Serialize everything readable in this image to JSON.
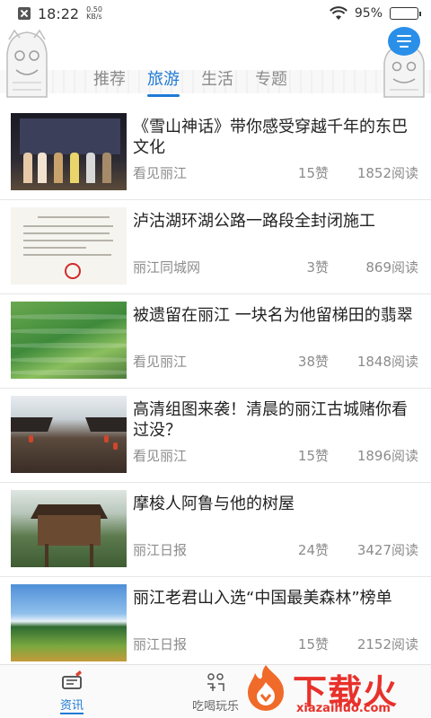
{
  "status_bar": {
    "time": "18:22",
    "speed_value": "0.50",
    "speed_unit": "KB/s",
    "battery": "95%",
    "battery_level": 0.95
  },
  "tabs": [
    {
      "label": "推荐",
      "active": false
    },
    {
      "label": "旅游",
      "active": true
    },
    {
      "label": "生活",
      "active": false
    },
    {
      "label": "专题",
      "active": false
    }
  ],
  "news": [
    {
      "title": "《雪山神话》带你感受穿越千年的东巴文化",
      "source": "看见丽江",
      "likes": "15赞",
      "reads": "1852阅读"
    },
    {
      "title": "泸沽湖环湖公路一路段全封闭施工",
      "source": "丽江同城网",
      "likes": "3赞",
      "reads": "869阅读"
    },
    {
      "title": "被遗留在丽江 一块名为他留梯田的翡翠",
      "source": "看见丽江",
      "likes": "38赞",
      "reads": "1848阅读"
    },
    {
      "title": "高清组图来袭！清晨的丽江古城赌你看过没？",
      "source": "看见丽江",
      "likes": "15赞",
      "reads": "1896阅读"
    },
    {
      "title": "摩梭人阿鲁与他的树屋",
      "source": "丽江日报",
      "likes": "24赞",
      "reads": "3427阅读"
    },
    {
      "title": "丽江老君山入选“中国最美森林”榜单",
      "source": "丽江日报",
      "likes": "15赞",
      "reads": "2152阅读"
    }
  ],
  "bottom_nav": [
    {
      "label": "资讯",
      "active": true,
      "icon": "news-icon"
    },
    {
      "label": "吃喝玩乐",
      "active": false,
      "icon": "food-fun-icon"
    }
  ],
  "watermark": {
    "text": "下载火",
    "url": "xiazaihuo.com"
  },
  "colors": {
    "accent": "#1e7ad6",
    "watermark": "#e8312b"
  }
}
